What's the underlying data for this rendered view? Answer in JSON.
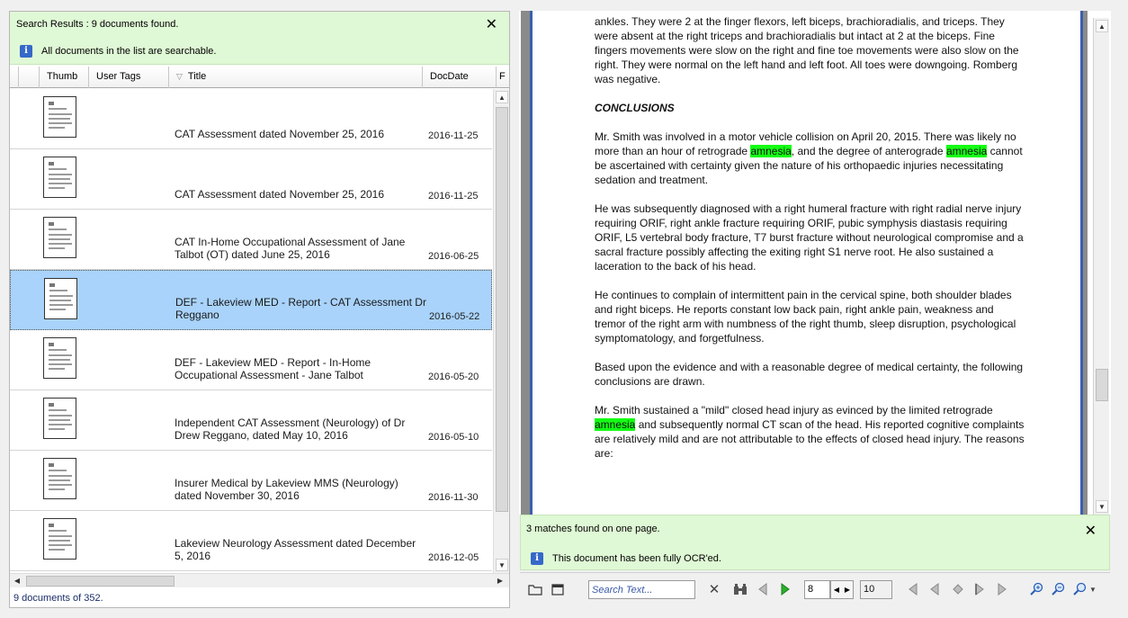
{
  "left": {
    "banner_title": "Search Results : 9 documents found.",
    "banner_close": "✕",
    "banner_info": "All documents in the list are searchable.",
    "columns": [
      "Thumb",
      "User Tags",
      "Title",
      "DocDate",
      "F"
    ],
    "rows": [
      {
        "title": "CAT Assessment dated November 25, 2016",
        "date": "2016-11-25"
      },
      {
        "title": "CAT Assessment dated November 25, 2016",
        "date": "2016-11-25"
      },
      {
        "title": "CAT In-Home Occupational Assessment of Jane Talbot (OT) dated June 25, 2016",
        "date": "2016-06-25"
      },
      {
        "title": "DEF - Lakeview MED - Report - CAT Assessment Dr Reggano",
        "date": "2016-05-22"
      },
      {
        "title": "DEF - Lakeview MED - Report - In-Home Occupational Assessment - Jane Talbot",
        "date": "2016-05-20"
      },
      {
        "title": "Independent CAT Assessment (Neurology) of Dr Drew Reggano, dated May 10, 2016",
        "date": "2016-05-10"
      },
      {
        "title": "Insurer Medical by Lakeview MMS (Neurology) dated November 30, 2016",
        "date": "2016-11-30"
      },
      {
        "title": "Lakeview Neurology Assessment dated December 5, 2016",
        "date": "2016-12-05"
      }
    ],
    "status": "9 documents of 352."
  },
  "doc": {
    "para1": "ankles. They were 2 at the finger flexors, left biceps, brachioradialis, and triceps. They were absent at the right triceps and brachioradialis but intact at 2 at the biceps. Fine fingers movements were slow on the right and fine toe movements were also slow on the right. They were normal on the left hand and left foot. All toes were downgoing. Romberg was negative.",
    "heading": "CONCLUSIONS",
    "para2_a": "Mr. Smith was involved in a motor vehicle collision on April 20, 2015. There was likely no more than an hour of retrograde ",
    "para2_hl1": "amnesia",
    "para2_b": ", and the degree of anterograde ",
    "para2_hl2": "amnesia",
    "para2_c": " cannot be ascertained with certainty given the nature of his orthopaedic injuries necessitating sedation and treatment.",
    "para3": "He was subsequently diagnosed with a right humeral fracture with right radial nerve injury requiring ORIF, right ankle fracture requiring ORIF, pubic symphysis diastasis requiring ORIF, L5 vertebral body fracture, T7 burst fracture without neurological compromise and a sacral fracture possibly affecting the exiting right S1 nerve root. He also sustained a laceration to the back of his head.",
    "para4": "He continues to complain of intermittent pain in the cervical spine, both shoulder blades and right biceps. He reports constant low back pain, right ankle pain, weakness and tremor of the right arm with numbness of the right thumb, sleep disruption, psychological symptomatology, and forgetfulness.",
    "para5": "Based upon the evidence and with a reasonable degree of medical certainty, the following conclusions are drawn.",
    "para6_a": "Mr. Smith sustained a \"mild\" closed head injury as evinced by the limited retrograde ",
    "para6_hl": "amnesia",
    "para6_b": " and subsequently normal CT scan of the head. His reported cognitive complaints are relatively mild and are not attributable to the effects of closed head injury. The reasons are:",
    "highlight_color": "#14ff14"
  },
  "right": {
    "match_msg": "3 matches found on one page.",
    "match_close": "✕",
    "ocr_msg": "This document has been fully OCR'ed.",
    "search_placeholder": "Search Text...",
    "page_current": "8",
    "page_total": "10"
  }
}
